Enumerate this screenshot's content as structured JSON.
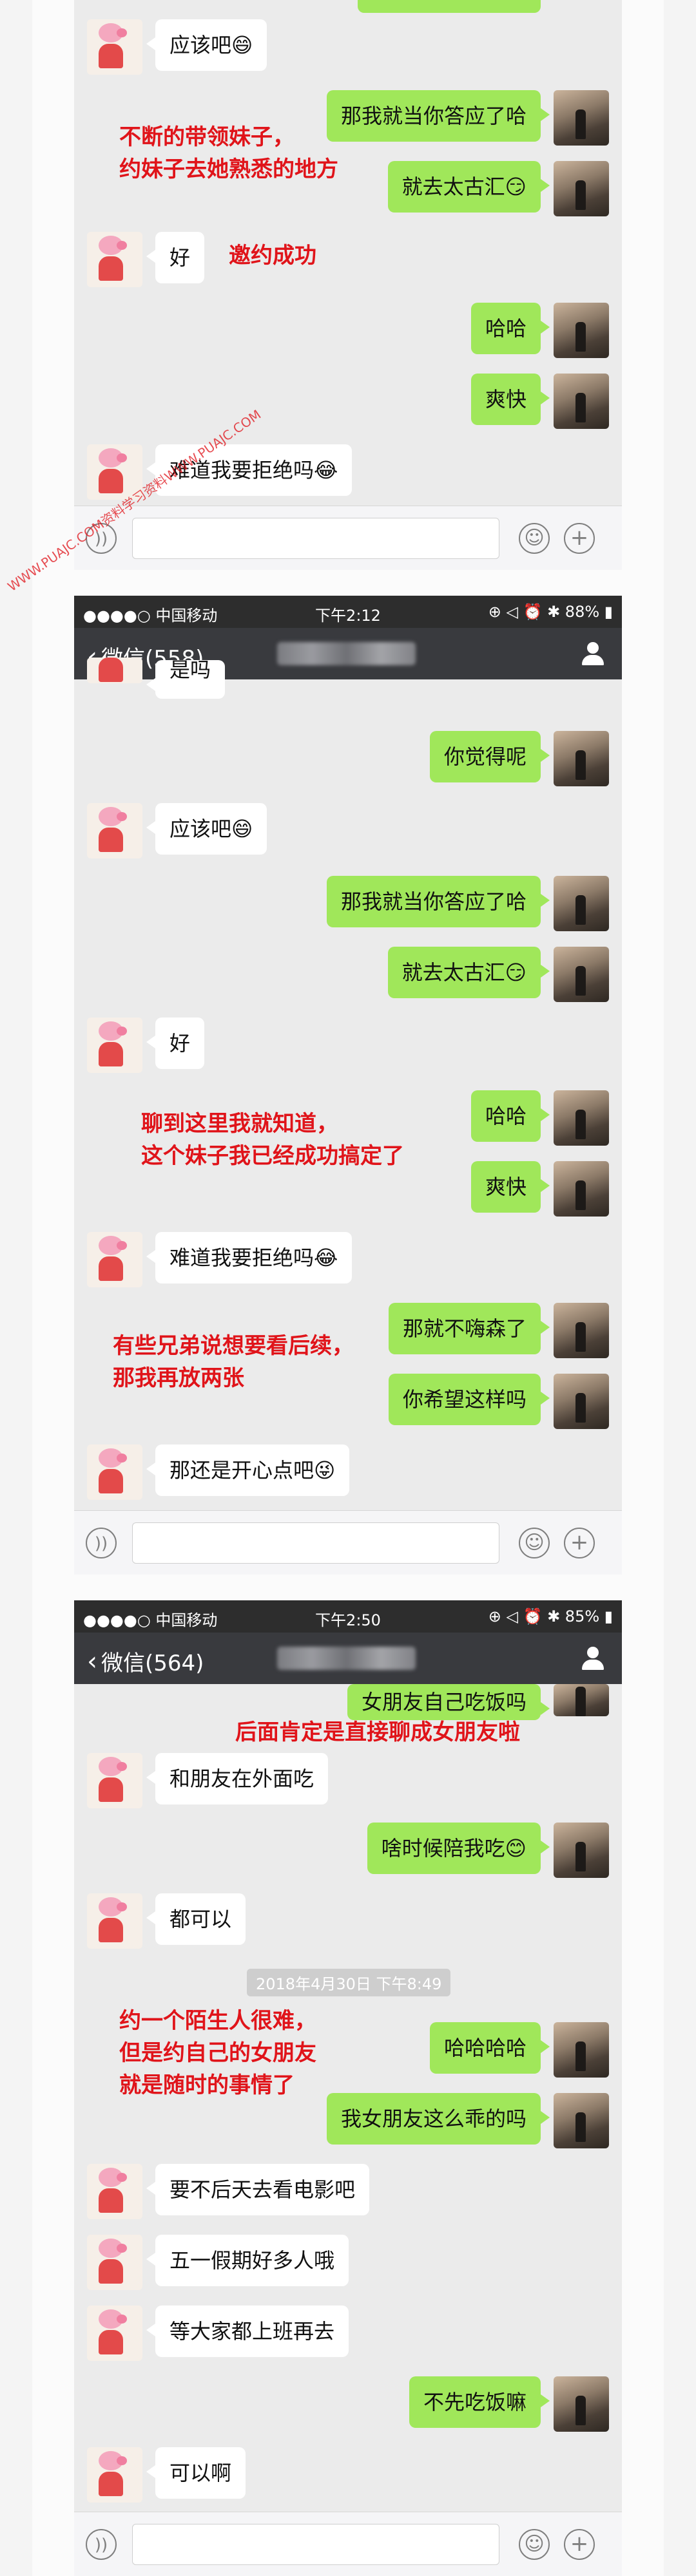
{
  "panel1": {
    "messages": [
      {
        "text": "应该吧😄"
      },
      {
        "text": "那我就当你答应了哈"
      },
      {
        "text": "就去太古汇😏"
      },
      {
        "text": "好"
      },
      {
        "text": "哈哈"
      },
      {
        "text": "爽快"
      },
      {
        "text": "难道我要拒绝吗😂"
      }
    ],
    "annotations": [
      "不断的带领妹子，",
      "约妹子去她熟悉的地方",
      "邀约成功"
    ]
  },
  "panel2": {
    "status": {
      "carrier": "●●●●○ 中国移动",
      "time": "下午2:12",
      "right": "⊕ ◁ ⏰ ✱ 88% ▮"
    },
    "nav": {
      "back_label": "微信(558)"
    },
    "messages": [
      {
        "text": "是吗"
      },
      {
        "text": "你觉得呢"
      },
      {
        "text": "应该吧😄"
      },
      {
        "text": "那我就当你答应了哈"
      },
      {
        "text": "就去太古汇😏"
      },
      {
        "text": "好"
      },
      {
        "text": "哈哈"
      },
      {
        "text": "爽快"
      },
      {
        "text": "难道我要拒绝吗😂"
      },
      {
        "text": "那就不嗨森了"
      },
      {
        "text": "你希望这样吗"
      },
      {
        "text": "那还是开心点吧😜"
      }
    ],
    "annotations": [
      "聊到这里我就知道，",
      "这个妹子我已经成功搞定了",
      "有些兄弟说想要看后续，",
      "那我再放两张"
    ]
  },
  "panel3": {
    "status": {
      "carrier": "●●●●○ 中国移动",
      "time": "下午2:50",
      "right": "⊕ ◁ ⏰ ✱ 85% ▮"
    },
    "nav": {
      "back_label": "微信(564)"
    },
    "messages": [
      {
        "text": "女朋友自己吃饭吗"
      },
      {
        "text": "和朋友在外面吃"
      },
      {
        "text": "啥时候陪我吃😊"
      },
      {
        "text": "都可以"
      },
      {
        "text": "哈哈哈哈"
      },
      {
        "text": "我女朋友这么乖的吗"
      },
      {
        "text": "要不后天去看电影吧"
      },
      {
        "text": "五一假期好多人哦"
      },
      {
        "text": "等大家都上班再去"
      },
      {
        "text": "不先吃饭嘛"
      },
      {
        "text": "可以啊"
      }
    ],
    "timestamp": "2018年4月30日 下午8:49",
    "annotations": [
      "后面肯定是直接聊成女朋友啦",
      "约一个陌生人很难，",
      "但是约自己的女朋友",
      "就是随时的事情了"
    ]
  },
  "watermark": "WWW.PUAJC.COM资料学习资料WWW.PUAJC.COM",
  "icons": {
    "voice": "voice-icon",
    "emoji": "emoji-icon",
    "plus": "plus-icon",
    "back": "chevron-left-icon",
    "profile": "person-icon"
  },
  "colors": {
    "bubble_out": "#a0e75a",
    "bubble_in": "#ffffff",
    "annotation": "#e0141a",
    "navbar": "#393a3e",
    "statusbar": "#2d2d2d"
  }
}
